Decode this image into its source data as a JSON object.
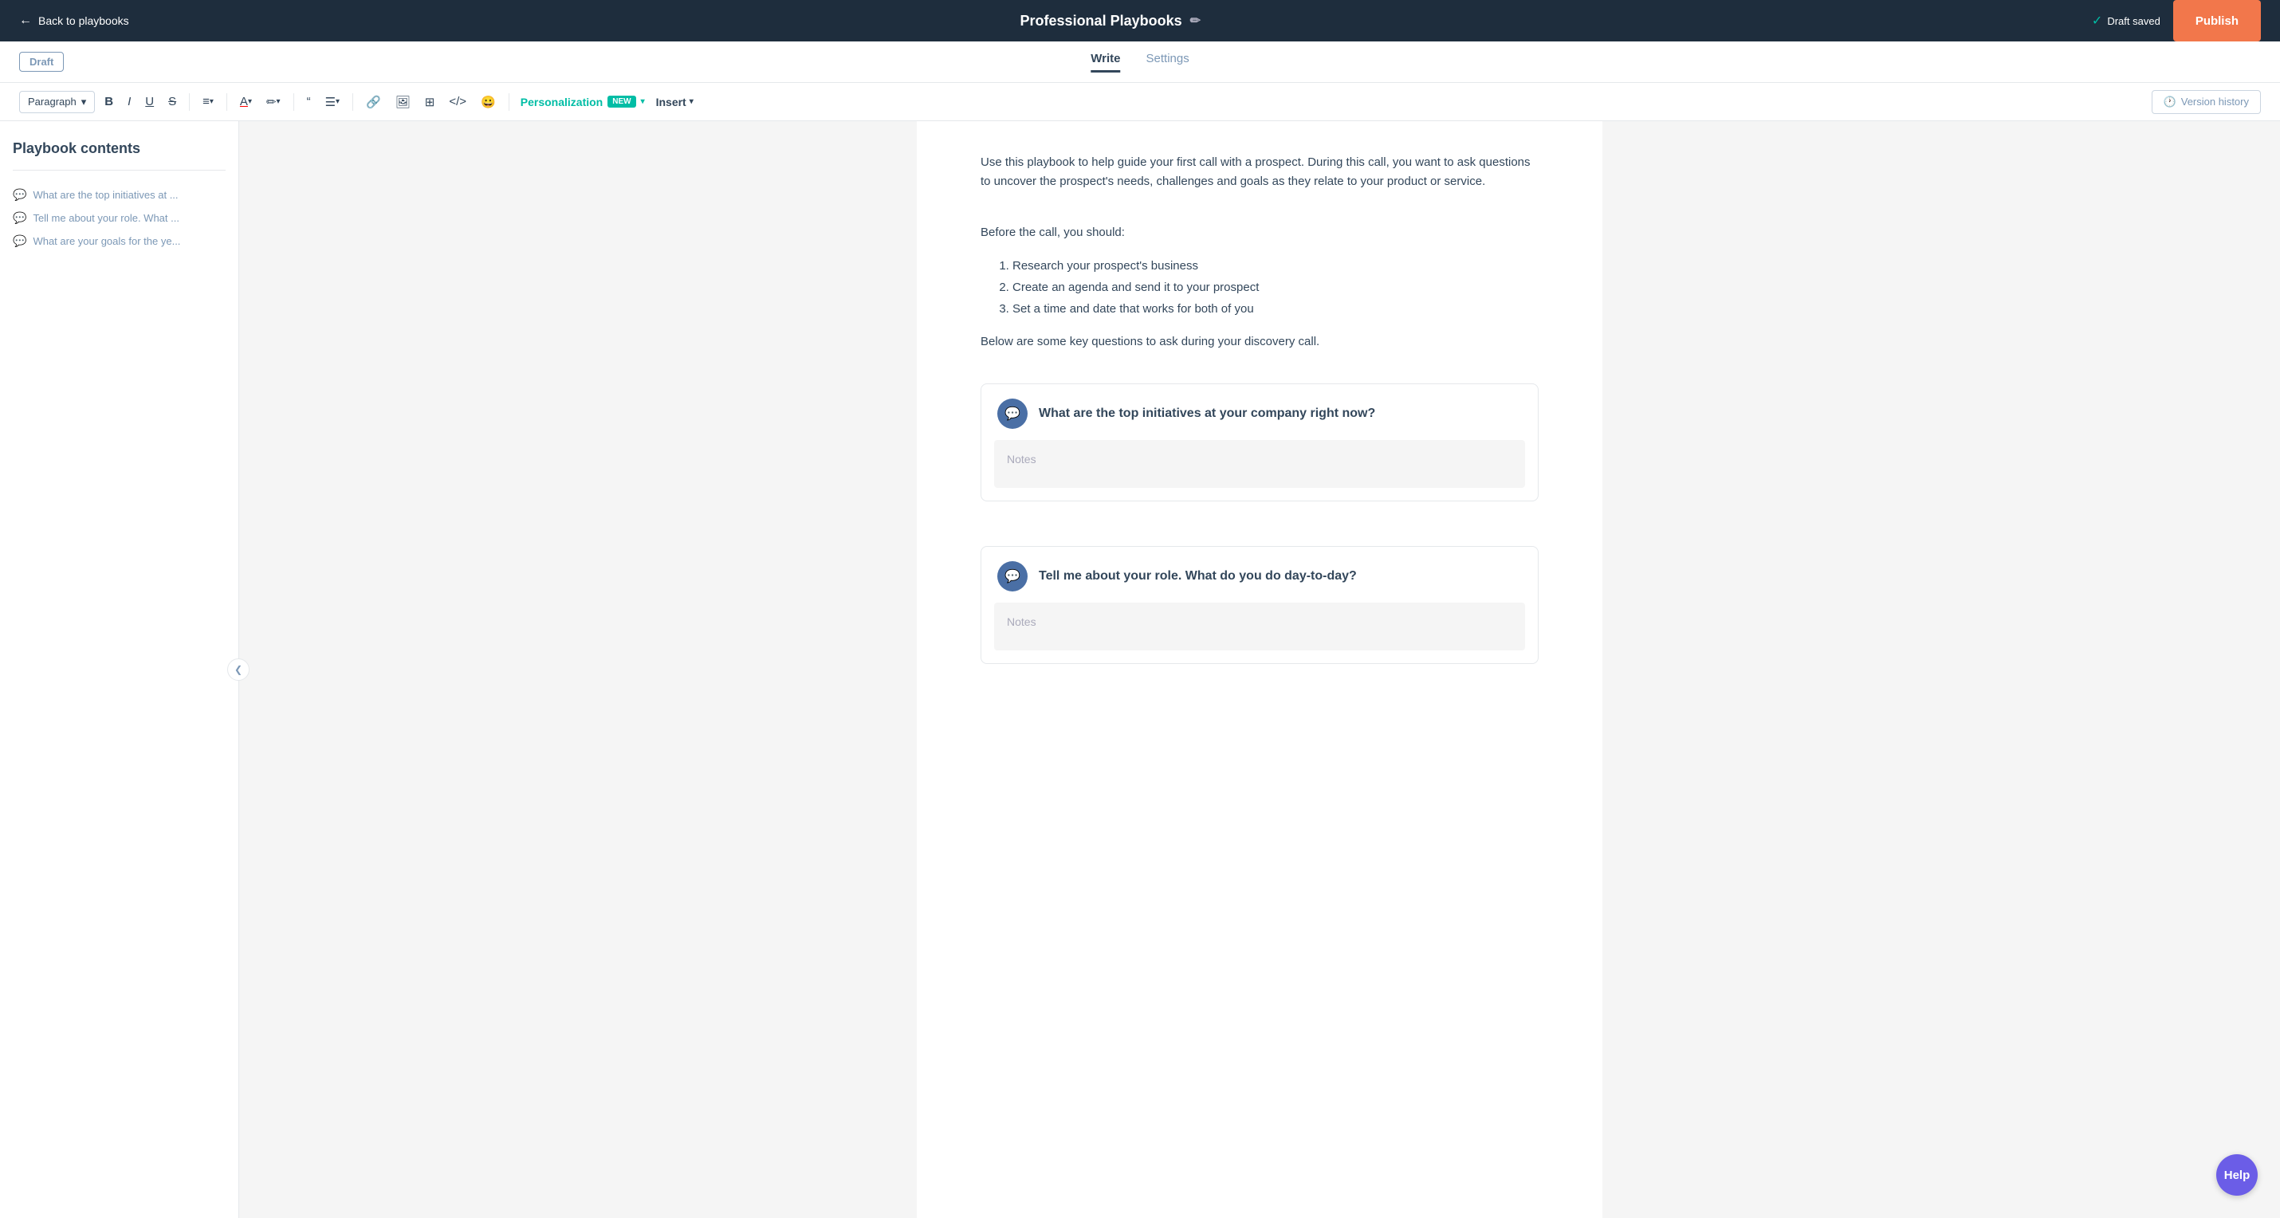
{
  "topNav": {
    "back_label": "Back to playbooks",
    "title": "Professional Playbooks",
    "draft_saved_label": "Draft saved",
    "publish_label": "Publish"
  },
  "secondaryNav": {
    "draft_badge": "Draft",
    "tabs": [
      {
        "id": "write",
        "label": "Write",
        "active": true
      },
      {
        "id": "settings",
        "label": "Settings",
        "active": false
      }
    ]
  },
  "toolbar": {
    "paragraph_label": "Paragraph",
    "bold_icon": "B",
    "italic_icon": "I",
    "underline_icon": "U",
    "strikethrough_icon": "S",
    "list_icon": "≡",
    "font_color_icon": "A",
    "highlight_icon": "✏",
    "quote_icon": "❝",
    "align_icon": "☰",
    "link_icon": "🔗",
    "image_icon": "🖼",
    "table_icon": "⊞",
    "code_icon": "< >",
    "emoji_icon": "😊",
    "personalization_label": "Personalization",
    "new_badge": "NEW",
    "insert_label": "Insert",
    "version_history_label": "Version history"
  },
  "sidebar": {
    "title": "Playbook contents",
    "items": [
      {
        "id": "item1",
        "label": "What are the top initiatives at ..."
      },
      {
        "id": "item2",
        "label": "Tell me about your role. What ..."
      },
      {
        "id": "item3",
        "label": "What are your goals for the ye..."
      }
    ]
  },
  "editor": {
    "intro_paragraph": "Use this playbook to help guide your first call with a prospect. During this call, you want to ask questions to uncover the prospect's needs, challenges and goals as they relate to your product or service.",
    "before_call_heading": "Before the call, you should:",
    "before_call_list": [
      "Research your prospect's business",
      "Create an agenda and send it to your prospect",
      "Set a time and date that works for both of you"
    ],
    "key_questions_text": "Below are some key questions to ask during your discovery call.",
    "questions": [
      {
        "id": "q1",
        "title": "What are the top initiatives at your company right now?",
        "notes_placeholder": "Notes"
      },
      {
        "id": "q2",
        "title": "Tell me about your role. What do you do day-to-day?",
        "notes_placeholder": "Notes"
      }
    ]
  },
  "help": {
    "label": "Help"
  }
}
